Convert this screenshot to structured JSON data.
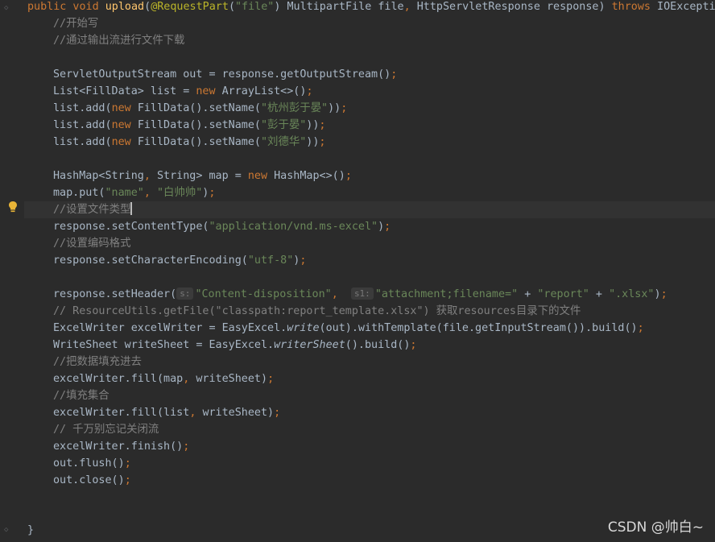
{
  "code": {
    "line1": {
      "mod": "public void ",
      "fn": "upload",
      "p1": "(",
      "ann": "@RequestPart",
      "p2": "(",
      "s1": "\"file\"",
      "p3": ") MultipartFile file",
      "c": ", ",
      "p4": "HttpServletResponse response) ",
      "kw": "throws ",
      "p5": "IOException"
    },
    "c1": "//开始写",
    "c2": "//通过输出流进行文件下载",
    "l5": {
      "a": "ServletOutputStream out = response.getOutputStream()",
      "b": ";"
    },
    "l6": {
      "a": "List<FillData> list = ",
      "kw": "new ",
      "b": "ArrayList<>()",
      "c": ";"
    },
    "l7": {
      "a": "list.add(",
      "kw": "new ",
      "b": "FillData().setName(",
      "s": "\"杭州彭于晏\"",
      "c": "))",
      "d": ";"
    },
    "l8": {
      "a": "list.add(",
      "kw": "new ",
      "b": "FillData().setName(",
      "s": "\"彭于晏\"",
      "c": "))",
      "d": ";"
    },
    "l9": {
      "a": "list.add(",
      "kw": "new ",
      "b": "FillData().setName(",
      "s": "\"刘德华\"",
      "c": "))",
      "d": ";"
    },
    "l11": {
      "a": "HashMap<String",
      "comma": ", ",
      "b": "String> map = ",
      "kw": "new ",
      "c": "HashMap<>()",
      "d": ";"
    },
    "l12": {
      "a": "map.put(",
      "s1": "\"name\"",
      "comma": ", ",
      "s2": "\"白帅帅\"",
      "b": ")",
      "d": ";"
    },
    "c3": "//设置文件类型",
    "l14": {
      "a": "response.setContentType(",
      "s": "\"application/vnd.ms-excel\"",
      "b": ")",
      "d": ";"
    },
    "c4": "//设置编码格式",
    "l16": {
      "a": "response.setCharacterEncoding(",
      "s": "\"utf-8\"",
      "b": ")",
      "d": ";"
    },
    "l18": {
      "a": "response.setHeader(",
      "h1": "s:",
      "s1": "\"Content-disposition\"",
      "comma": ",  ",
      "h2": "s1:",
      "s2": "\"attachment;filename=\"",
      "plus1": " + ",
      "s3": "\"report\"",
      "plus2": " + ",
      "s4": "\".xlsx\"",
      "b": ")",
      "d": ";"
    },
    "c5": "// ResourceUtils.getFile(\"classpath:report_template.xlsx\") 获取resources目录下的文件",
    "l20": {
      "a": "ExcelWriter excelWriter = EasyExcel.",
      "it": "write",
      "b": "(out).withTemplate(file.getInputStream()).build()",
      "d": ";"
    },
    "l21": {
      "a": "WriteSheet writeSheet = EasyExcel.",
      "it": "writerSheet",
      "b": "().build()",
      "d": ";"
    },
    "c6": "//把数据填充进去",
    "l23": {
      "a": "excelWriter.fill(map",
      "comma": ", ",
      "b": "writeSheet)",
      "d": ";"
    },
    "c7": "//填充集合",
    "l25": {
      "a": "excelWriter.fill(list",
      "comma": ", ",
      "b": "writeSheet)",
      "d": ";"
    },
    "c8": "// 千万别忘记关闭流",
    "l27": {
      "a": "excelWriter.finish()",
      "d": ";"
    },
    "l28": {
      "a": "out.flush()",
      "d": ";"
    },
    "l29": {
      "a": "out.close()",
      "d": ";"
    },
    "close": "}"
  },
  "watermark": "CSDN @帅白~",
  "icons": {
    "gutter": "intention-bulb-icon"
  }
}
